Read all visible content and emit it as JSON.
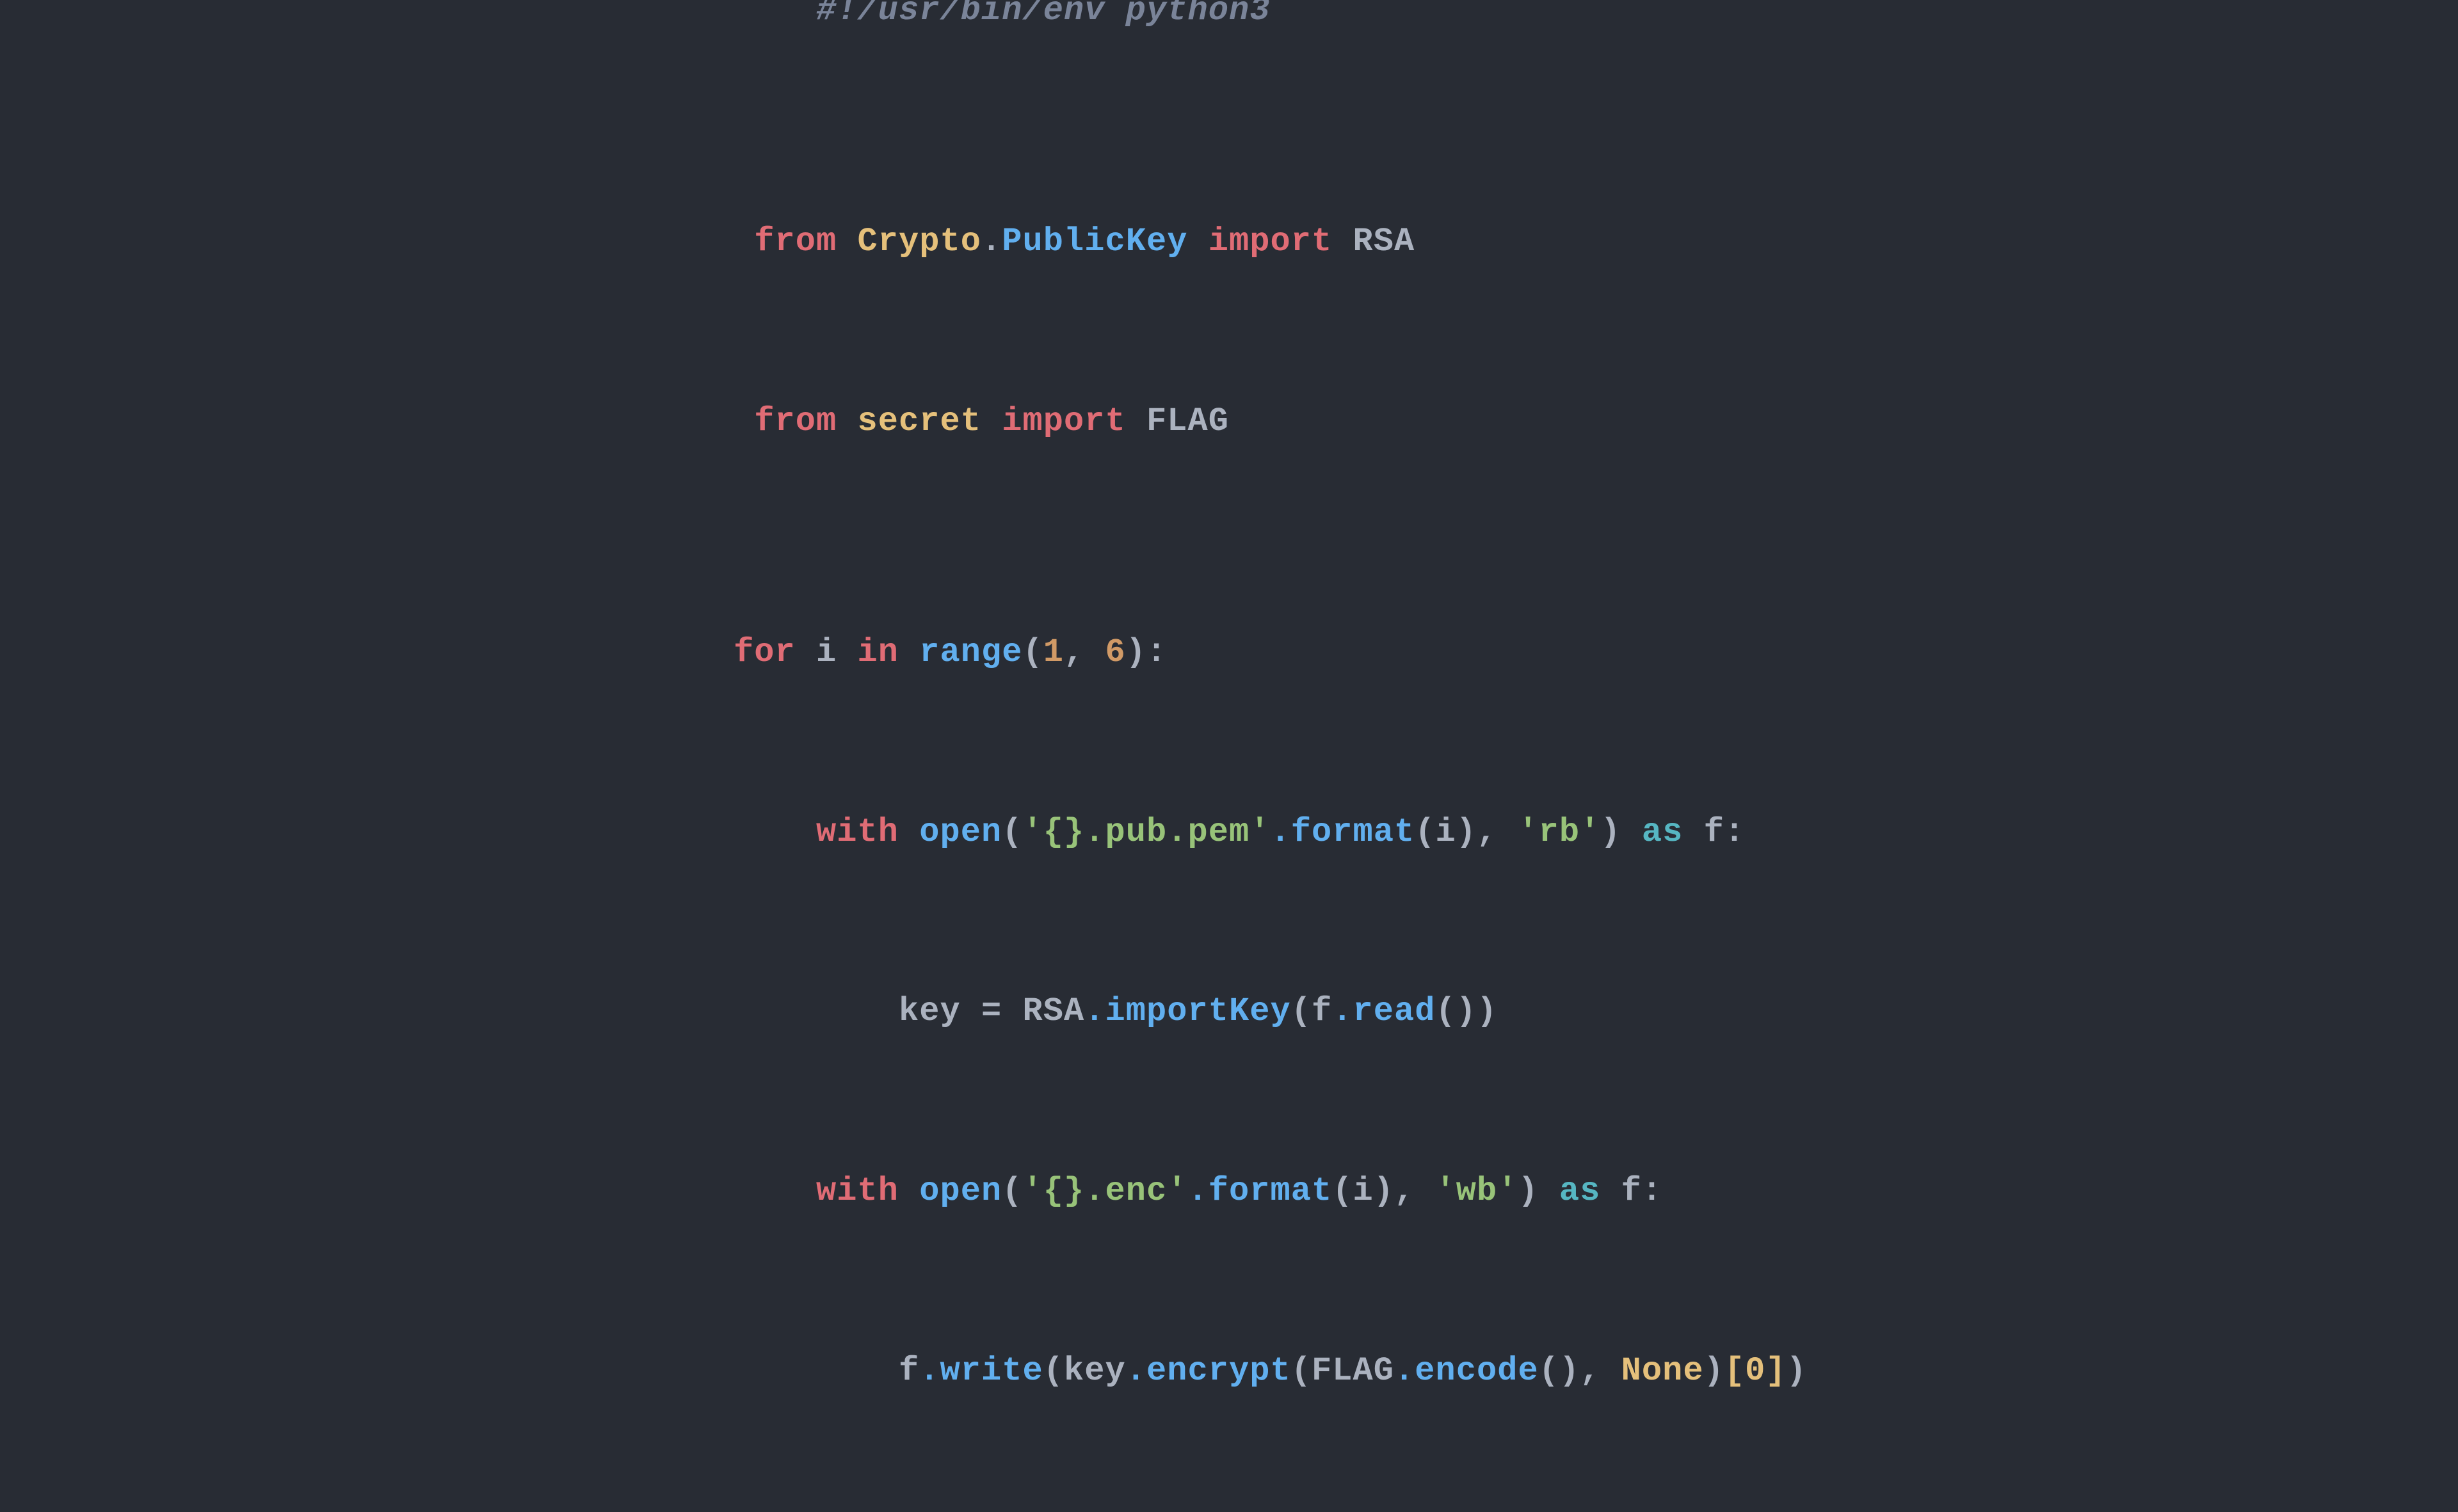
{
  "background": "#282c34",
  "code": {
    "line1": "#!/usr/bin/env python3",
    "line2_from": "from",
    "line2_module": "Crypto",
    "line2_dot": ".",
    "line2_class": "PublicKey",
    "line2_import": "import",
    "line2_name": "RSA",
    "line3_from": "from",
    "line3_module": "secret",
    "line3_import": "import",
    "line3_name": "FLAG",
    "line4_for": "for",
    "line4_var": "i",
    "line4_in": "in",
    "line4_range": "range",
    "line4_args": "(1, 6):",
    "line5_with": "with",
    "line5_open": "open",
    "line5_str1": "'{}.pub.pem'",
    "line5_format": ".format",
    "line5_args1": "(i),",
    "line5_str2": "'rb'",
    "line5_as": "as",
    "line5_f": "f:",
    "line6_key": "key",
    "line6_eq": "=",
    "line6_rsa": "RSA",
    "line6_importKey": ".importKey",
    "line6_f": "(f",
    "line6_read": ".read",
    "line6_end": "())",
    "line7_with": "with",
    "line7_open": "open",
    "line7_str1": "'{}.enc'",
    "line7_format": ".format",
    "line7_args1": "(i),",
    "line7_str2": "'wb'",
    "line7_as": "as",
    "line7_f": "f:",
    "line8_f": "f",
    "line8_write": ".write",
    "line8_key": "(key",
    "line8_encrypt": ".encrypt",
    "line8_flag": "(FLAG",
    "line8_encode": ".encode",
    "line8_none": "(), None)",
    "line8_idx": "[0])"
  }
}
